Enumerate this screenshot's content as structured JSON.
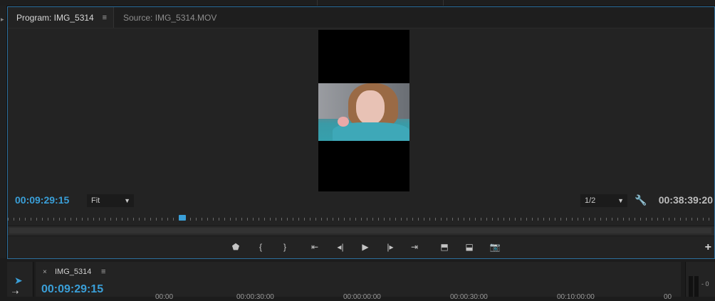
{
  "program_monitor": {
    "tabs": [
      {
        "label": "Program: IMG_5314",
        "menu": "≡",
        "active": true
      },
      {
        "label": "Source: IMG_5314.MOV",
        "active": false
      }
    ],
    "current_timecode": "00:09:29:15",
    "duration_timecode": "00:38:39:20",
    "zoom": {
      "selected": "Fit"
    },
    "resolution": {
      "selected": "1/2"
    },
    "playhead_position_fraction": 0.246,
    "transport": [
      {
        "icon": "marker-icon",
        "glyph": "⬟"
      },
      {
        "icon": "mark-in-icon",
        "glyph": "{"
      },
      {
        "icon": "mark-out-icon",
        "glyph": "}"
      },
      {
        "icon": "go-to-in-icon",
        "glyph": "⇤"
      },
      {
        "icon": "step-back-icon",
        "glyph": "◂|"
      },
      {
        "icon": "play-icon",
        "glyph": "▶"
      },
      {
        "icon": "step-forward-icon",
        "glyph": "|▸"
      },
      {
        "icon": "go-to-out-icon",
        "glyph": "⇥"
      },
      {
        "icon": "lift-icon",
        "glyph": "⬒"
      },
      {
        "icon": "extract-icon",
        "glyph": "⬓"
      },
      {
        "icon": "export-frame-icon",
        "glyph": "📷"
      }
    ],
    "add_button": "+",
    "accent_color": "#3a9fd8"
  },
  "timeline": {
    "close": "×",
    "sequence_name": "IMG_5314",
    "menu": "≡",
    "current_timecode": "00:09:29:15",
    "ruler_labels": [
      "00:00",
      "00:00:30:00",
      "00:00:00:00",
      "00:00:30:00",
      "00:10:00:00",
      "00"
    ]
  },
  "audio_meter": {
    "label": "- 0"
  }
}
